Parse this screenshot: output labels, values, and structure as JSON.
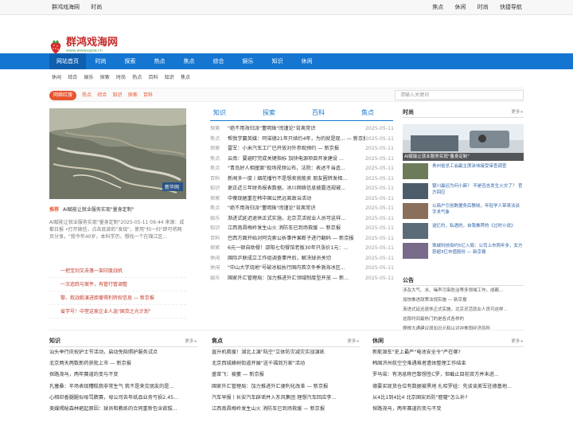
{
  "topbar": {
    "left": [
      "群鸿戏海网",
      "时尚"
    ],
    "right": [
      "焦点",
      "休闲",
      "时尚",
      "快捷导航"
    ]
  },
  "logo": {
    "title": "群鸿戏海网",
    "url": "www.wwwugzw.cn"
  },
  "nav": [
    "网站首页",
    "时尚",
    "探索",
    "热点",
    "焦点",
    "综合",
    "娱乐",
    "知识",
    "休闲"
  ],
  "subnav": [
    "休闲",
    "综合",
    "娱乐",
    "探索",
    "时尚",
    "热点",
    "百科",
    "知识",
    "焦点"
  ],
  "hot": {
    "badge": "网络红搜",
    "links": [
      "热点",
      "综合",
      "知识",
      "探索",
      "百科"
    ],
    "search_placeholder": "请输入关键词"
  },
  "focus": {
    "tag": "推荐",
    "title": "AI赋能让就业服务实现\"量身定制\"",
    "desc": "AI赋能让就业服务实现\"量身定制\"2025-05-11 09:44 来源：成都日报 •打开微信，点击底部的\"发现\"，使用\"扫一扫\"即可将网页分享。\"我今年40岁，本科学历，想找一个在锦江区..."
  },
  "redlist": [
    "一把宝剑又击落一架印度战机",
    "一次追踪与案件，有管行管调整",
    "黎、叙战毅演进距撤得利转权信息 — 新京报",
    "省学号！中堂这家企业人选\"国货之光计划\""
  ],
  "tabs": [
    "知识",
    "探索",
    "百科",
    "焦点"
  ],
  "mainlist": [
    {
      "c": "探索",
      "t": "\"绝不用海归派\"董明珠\"闰谨论\"背离常识",
      "d": "2025-05-11"
    },
    {
      "c": "焦点",
      "t": "帮我学赢英媒：阿诺德21年只续约4年，为的就是现... — 新京报",
      "d": "2025-05-11"
    },
    {
      "c": "探索",
      "t": "雷军：小米汽车工厂已开放对外参观预约 — 新京报",
      "d": "2025-05-11"
    },
    {
      "c": "焦点",
      "t": "云南：要避盯完成关键指标 加快电源项目开发建设 ...",
      "d": "2025-05-11"
    },
    {
      "c": "焦点",
      "t": "\"青岛好人相撞案\"现场视频公布，法院：表述不当造...",
      "d": "2025-05-11"
    },
    {
      "c": "百科",
      "t": "新闻多一度丨烟花播竹不是想卖就能卖 朋友圈转发相...",
      "d": "2025-05-11"
    },
    {
      "c": "知识",
      "t": "更正近三年财务报表数据，冰川网络信息披露违规被...",
      "d": "2025-05-11"
    },
    {
      "c": "探索",
      "t": "中傻现据重在韩中国公民远离政治活动",
      "d": "2025-05-11"
    },
    {
      "c": "焦点",
      "t": "\"绝不用海归派\"董明珠\"闰谨论\"背离常识",
      "d": "2025-05-11"
    },
    {
      "c": "娱乐",
      "t": "渐进式延迟退休正式实施，北京灵活就业人员可这样...",
      "d": "2025-05-11"
    },
    {
      "c": "知识",
      "t": "江西南昌梅岭发生山火 消防车已到场救援 — 新京报",
      "d": "2025-05-11"
    },
    {
      "c": "百科",
      "t": "巴西方面开始对阿克索公析事件果断子进行翻码 — 新京报",
      "d": "2025-05-11"
    },
    {
      "c": "探索",
      "t": "6元一顿自助餐！邵阳七旬餐馆老板30年只涨价1元：...",
      "d": "2025-05-11"
    },
    {
      "c": "休闲",
      "t": "国际乒联成立工作组调查事件后，解决球员关切",
      "d": "2025-05-11"
    },
    {
      "c": "休闲",
      "t": "\"中山大学烧地\"号破冰船执行国内首次冬季渤海冰区...",
      "d": "2025-05-11"
    },
    {
      "c": "娱乐",
      "t": "国家外汇管理局：加力推进外汇领域制度型开放 — 新...",
      "d": "2025-05-11"
    }
  ],
  "side": {
    "title": "时尚",
    "more": "更多+",
    "big_caption": "AI赋能让就业服务实现\"量身定制\"",
    "items": [
      "贵州省总工会副主席涂伟接受审查调查",
      "银川最迟为何小麻？ 不是否吉发生火灾了？ 官方回应",
      "以商户引创数据务后教晓，年轻学人带来法谈字术气象",
      "追忆约，私遇的，自我推荐的《过时小说》",
      "珠城科技拟约5亿入局：公司上市两年多，女方获超3亿市值股份 — 新京报"
    ]
  },
  "notice": {
    "title": "公告",
    "lines": [
      "涉及大气、水、噪声污染防治等多领域工作。成都...",
      "加快推进政策法规实施 — 新京报",
      "渐进式延迟退休正式实施，北京灵活就业人员可这样...",
      "这段时间最热门的是各式各样的",
      "摩根大通建议增加日元和以对冲美国经济风险"
    ]
  },
  "cols": [
    {
      "title": "知识",
      "more": "更多+",
      "lines": [
        "汕头举行庆祝护士节活动，启动免陪照护服务试点",
        "北京两天两数新药获批上市 — 新京报",
        "探路茂马，两年赛道的变与不变",
        "孔塞桑：半场表现糟糕我非常生气 我不是来交朋友的是...",
        "心相印香腿腿似母骂脾赛，母公司去年纸品业务亏损2.45...",
        "美媒揭秘森林砸起原因：球员和教练的合同重新包含欲拔..."
      ]
    },
    {
      "title": "焦点",
      "more": "更多+",
      "lines": [
        "直升机救援！湖北上演\"陆空\"立体防灾减灾实战演练",
        "北京西城峰树街道开展\"送千福到万家\"活动",
        "盛草飞：被萎 — 新京报",
        "国家外汇管理局：加力推进外汇便利化改革 — 新京报",
        "汽车早报丨长安汽车辟谣并入东风集团 理想汽车回应李...",
        "江西南昌梅岭发生山火 消防车已到场救援 — 新京报"
      ]
    },
    {
      "title": "休闲",
      "more": "更多+",
      "lines": [
        "新能源车\"史上最严\"电池安全令\"严在哪?",
        "韩国济州航空空难遇难者遗体整理工作结束",
        "罗马诺：有消息称巴黎想签C罗，但截止目前双方并未进...",
        "德要买现货仓位有数据被黑地 扎哈罗娃：先谈谈美军驻德基地...",
        "从4比1到4比4 北京国安后防\"窟窿\"怎么补?",
        "探路茂马，两年赛道的变与不变"
      ]
    }
  ]
}
